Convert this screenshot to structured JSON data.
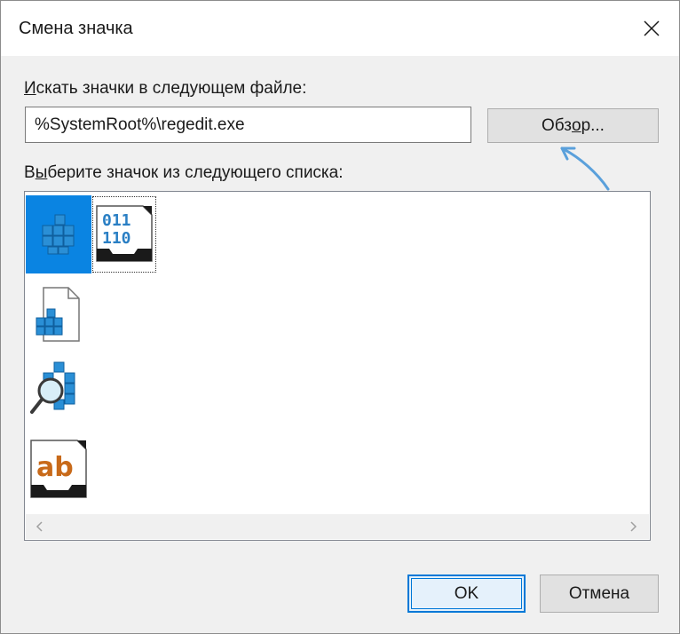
{
  "window": {
    "title": "Смена значка"
  },
  "search": {
    "label_prefix": "И",
    "label_accel": "",
    "label_rest": "скать значки в следующем файле:",
    "path_value": "%SystemRoot%\\regedit.exe"
  },
  "browse": {
    "label_before": "Обз",
    "label_accel": "о",
    "label_after": "р..."
  },
  "list": {
    "label_before": "В",
    "label_accel": "ы",
    "label_after": "берите значок из следующего списка:",
    "icons": [
      {
        "name": "registry-editor-icon",
        "selected": true
      },
      {
        "name": "binary-file-icon",
        "text_top": "011",
        "text_bottom": "110",
        "focused": true
      },
      {
        "name": "registry-file-icon"
      },
      {
        "name": "registry-search-icon"
      },
      {
        "name": "string-value-icon",
        "text": "ab"
      }
    ]
  },
  "footer": {
    "ok_label": "OK",
    "cancel_label": "Отмена"
  },
  "colors": {
    "accent": "#0078d7",
    "selection": "#0a84e2",
    "annotation_arrow": "#5aa0db"
  }
}
